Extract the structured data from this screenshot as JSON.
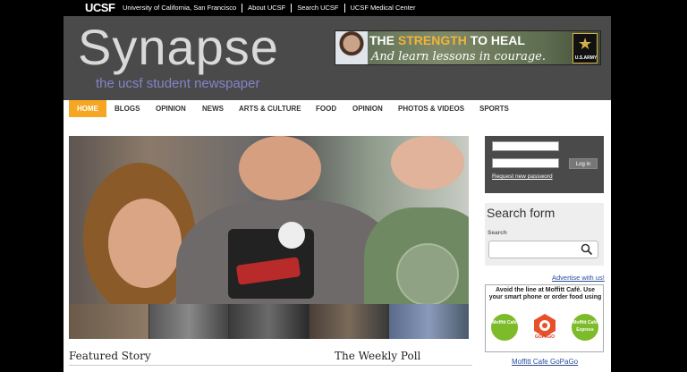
{
  "ucsf_bar": {
    "logo": "UCSF",
    "links": [
      "University of California, San Francisco",
      "About UCSF",
      "Search UCSF",
      "UCSF Medical Center"
    ]
  },
  "header": {
    "site_name": "Synapse",
    "slogan": "the ucsf student newspaper"
  },
  "banner_ad": {
    "line1_pre": "THE ",
    "line1_highlight": "STRENGTH",
    "line1_post": " TO HEAL",
    "line2": "And learn lessons in courage.",
    "brand": "U.S.ARMY"
  },
  "nav": {
    "items": [
      "HOME",
      "BLOGS",
      "OPINION",
      "NEWS",
      "ARTS & CULTURE",
      "FOOD",
      "OPINION",
      "PHOTOS & VIDEOS",
      "SPORTS"
    ],
    "active_index": 0
  },
  "login": {
    "button": "Log in",
    "request_password": "Request new password"
  },
  "search": {
    "title": "Search form",
    "label": "Search"
  },
  "sections": {
    "featured": "Featured Story",
    "poll": "The Weekly Poll"
  },
  "sidebar_ads": {
    "advertise": "Advertise with us!",
    "moffitt_text": "Avoid the line at Moffitt Café. Use your smart phone or order food using",
    "moffitt_logo": "Moffitt Café",
    "gopago_logo": "GOPAGO",
    "moffitt_express_logo": "Moffitt Café Express",
    "moffitt_link": "Moffitt Cafe GoPaGo"
  },
  "colors": {
    "header_bg": "#4a4a4a",
    "nav_active": "#f5a623",
    "slogan": "#8484c8",
    "link": "#2a4d9a"
  }
}
